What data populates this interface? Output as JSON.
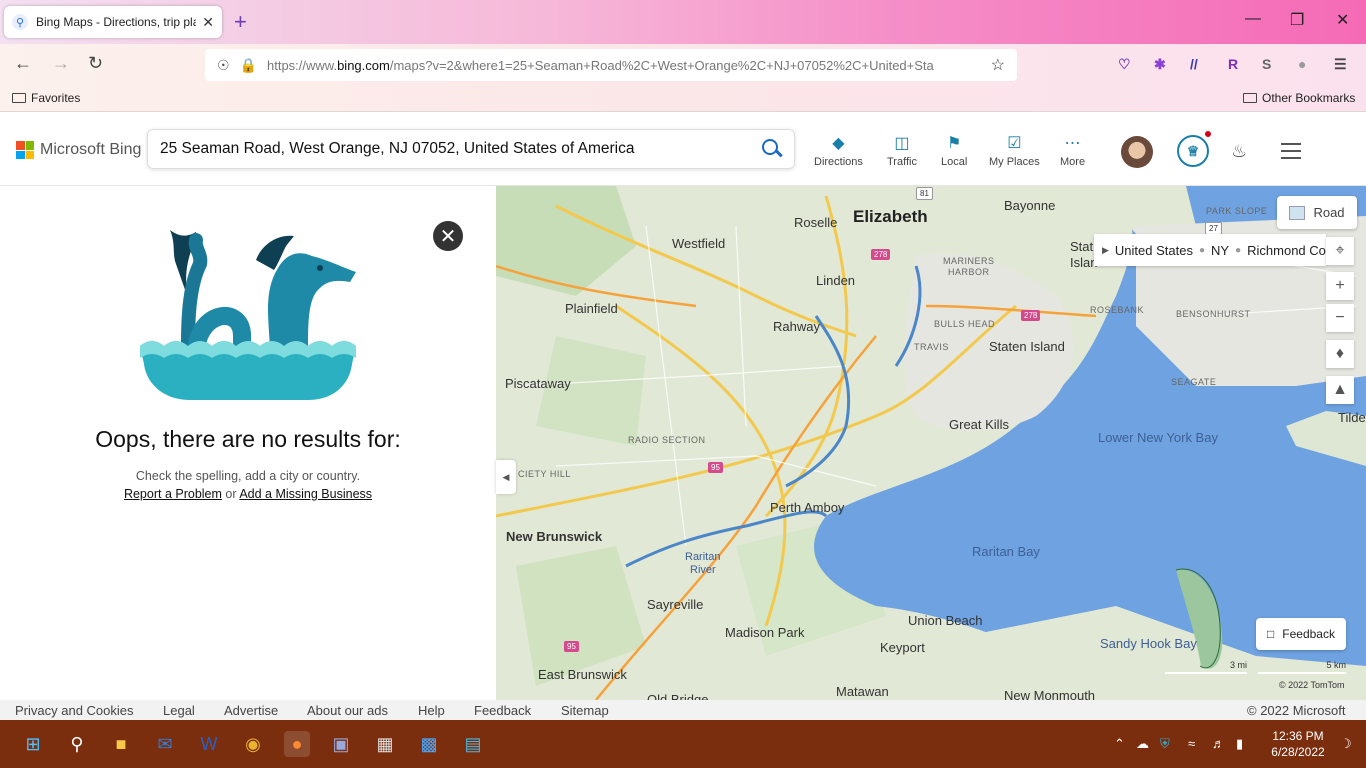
{
  "browser": {
    "tab_title": "Bing Maps - Directions, trip plan",
    "url_prefix": "https://www.",
    "url_domain": "bing.com",
    "url_rest": "/maps?v=2&where1=25+Seaman+Road%2C+West+Orange%2C+NJ+07052%2C+United+Sta",
    "bookmarks_left": "Favorites",
    "bookmarks_right": "Other Bookmarks"
  },
  "bing": {
    "logo_text": "Microsoft Bing",
    "search_value": "25 Seaman Road, West Orange, NJ 07052, United States of America",
    "nav": [
      "Directions",
      "Traffic",
      "Local",
      "My Places",
      "More"
    ]
  },
  "panel": {
    "heading": "Oops, there are no results for:",
    "hint": "Check the spelling, add a city or country.",
    "report_link": "Report a Problem",
    "or_text": "or",
    "add_link": "Add a Missing Business"
  },
  "map": {
    "style_button": "Road",
    "breadcrumb": [
      "United States",
      "NY",
      "Richmond Co."
    ],
    "feedback": "Feedback",
    "scale_mi": "3 mi",
    "scale_km": "5 km",
    "copyright": "© 2022 TomTom",
    "labels": {
      "elizabeth": "Elizabeth",
      "bayonne": "Bayonne",
      "roselle": "Roselle",
      "westfield": "Westfield",
      "linden": "Linden",
      "plainfield": "Plainfield",
      "rahway": "Rahway",
      "piscataway": "Piscataway",
      "mariners": "MARINERS",
      "harbor": "HARBOR",
      "bullshead": "BULLS HEAD",
      "travis": "TRAVIS",
      "statenisland": "Staten Island",
      "rosebank": "ROSEBANK",
      "bensonhurst": "BENSONHURST",
      "seagate": "SEAGATE",
      "parkslope": "PARK SLOPE",
      "stat": "Stat",
      "islan": "Islan",
      "greatkills": "Great Kills",
      "lowerny": "Lower New York Bay",
      "tilde": "Tilde",
      "radiosection": "RADIO SECTION",
      "cityhill": "CIETY HILL",
      "perthamboy": "Perth Amboy",
      "newbrunswick": "New Brunswick",
      "raritanbay": "Raritan Bay",
      "raritan": "Raritan",
      "river": "River",
      "sayreville": "Sayreville",
      "madisonpark": "Madison Park",
      "unionbeach": "Union Beach",
      "keyport": "Keyport",
      "sandyhook": "Sandy Hook Bay",
      "eastbrunswick": "East Brunswick",
      "matawan": "Matawan",
      "oldbridge": "Old Bridge",
      "newmonmouth": "New Monmouth"
    },
    "shields": {
      "s81": "81",
      "s278a": "278",
      "s278b": "278",
      "s27": "27",
      "s95a": "95",
      "s95b": "95"
    }
  },
  "footer": {
    "links": [
      "Privacy and Cookies",
      "Legal",
      "Advertise",
      "About our ads",
      "Help",
      "Feedback",
      "Sitemap"
    ],
    "copyright": "© 2022 Microsoft"
  },
  "taskbar": {
    "time": "12:36 PM",
    "date": "6/28/2022"
  }
}
